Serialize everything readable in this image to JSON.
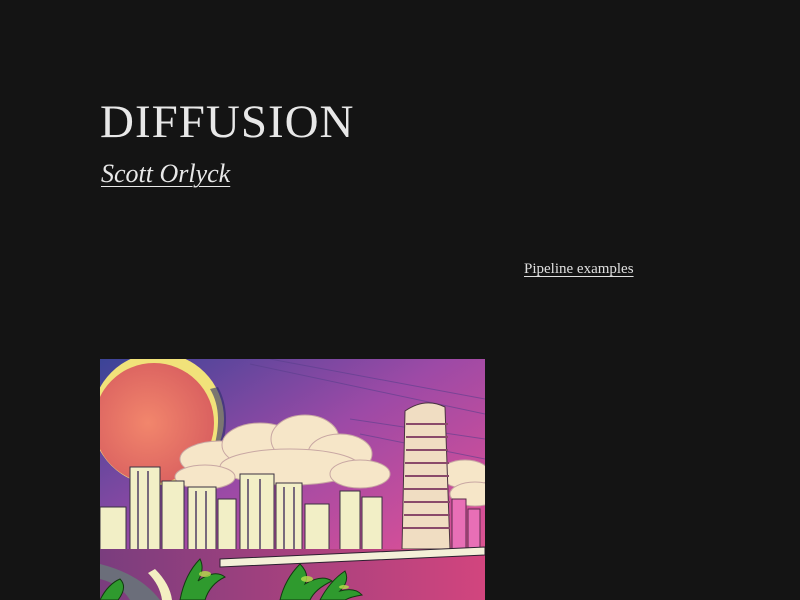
{
  "header": {
    "site_title": "DIFFUSION",
    "author": "Scott Orlyck"
  },
  "nav": {
    "pipeline_link": "Pipeline examples"
  },
  "post": {
    "image_name": "anime-city-sunset-image",
    "colors": {
      "sky_top": "#3a3f9a",
      "sky_mid": "#b04aa8",
      "sky_bottom": "#e0508f",
      "sun": "#e7786a",
      "sun_ring": "#f1e27a",
      "cloud": "#f6e7c9",
      "building": "#f2efc6",
      "palm": "#2f9a2e"
    }
  },
  "theme": {
    "background": "#141414",
    "text": "#e8e8e8"
  }
}
